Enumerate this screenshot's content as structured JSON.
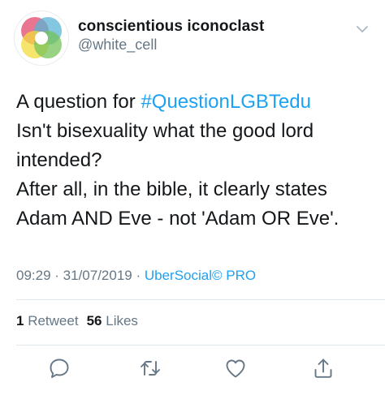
{
  "user": {
    "display_name": "conscientious iconoclast",
    "handle": "@white_cell"
  },
  "tweet": {
    "line1_prefix": "A question for ",
    "hashtag": "#QuestionLGBTedu",
    "line2": "Isn't bisexuality what the good lord",
    "line3": "intended?",
    "line4": "After all, in the bible, it clearly states",
    "line5": "Adam AND Eve - not 'Adam OR Eve'."
  },
  "meta": {
    "time": "09:29",
    "sep1": " · ",
    "date": "31/07/2019",
    "sep2": " · ",
    "source": "UberSocial© PRO"
  },
  "stats": {
    "retweets_count": "1",
    "retweets_label": "Retweet",
    "likes_count": "56",
    "likes_label": "Likes"
  },
  "actions": {
    "reply": "reply-icon",
    "retweet": "retweet-icon",
    "like": "heart-icon",
    "share": "share-icon"
  },
  "colors": {
    "link": "#1da1f2",
    "secondary": "#657786",
    "primary": "#14171a",
    "icon": "#657786"
  }
}
